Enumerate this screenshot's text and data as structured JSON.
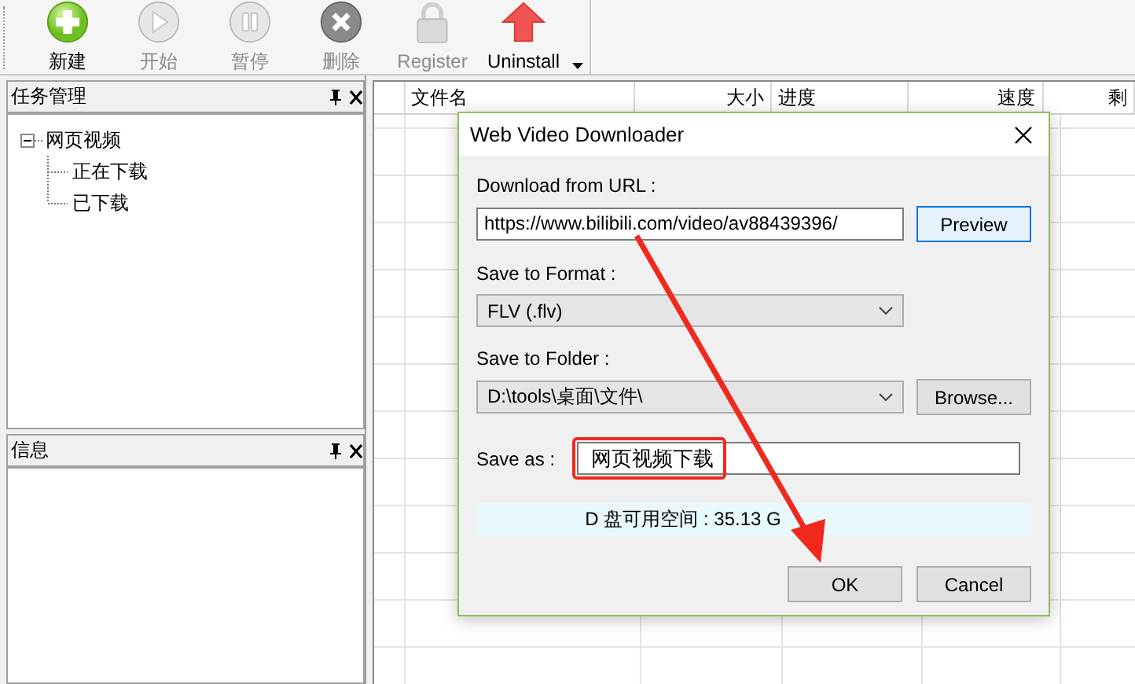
{
  "toolbar": {
    "items": [
      {
        "label": "新建",
        "disabled": false
      },
      {
        "label": "开始",
        "disabled": true
      },
      {
        "label": "暂停",
        "disabled": true
      },
      {
        "label": "删除",
        "disabled": true
      },
      {
        "label": "Register",
        "disabled": true
      },
      {
        "label": "Uninstall",
        "disabled": false
      }
    ]
  },
  "panels": [
    {
      "title": "任务管理",
      "tree": [
        {
          "label": "网页视频",
          "expanded": true,
          "children": [
            {
              "label": "正在下载"
            },
            {
              "label": "已下载"
            }
          ]
        }
      ]
    },
    {
      "title": "信息"
    }
  ],
  "table": {
    "columns": [
      "文件名",
      "大小",
      "进度",
      "速度",
      "剩"
    ]
  },
  "dialog": {
    "title": "Web Video Downloader",
    "url_label": "Download from URL :",
    "url_value": "https://www.bilibili.com/video/av88439396/",
    "preview_button": {
      "label": "Preview",
      "focused": true
    },
    "format_label": "Save to Format :",
    "format_value": "FLV (.flv)",
    "folder_label": "Save to Folder :",
    "folder_value": "D:\\tools\\桌面\\文件\\",
    "browse_button": {
      "label": "Browse...",
      "focused": false
    },
    "save_as_label": "Save as :",
    "save_as_value": "网页视频下载",
    "free_space": "D 盘可用空间 : 35.13 G",
    "ok_button": {
      "label": "OK",
      "focused": false
    },
    "cancel_button": {
      "label": "Cancel",
      "focused": false
    }
  }
}
